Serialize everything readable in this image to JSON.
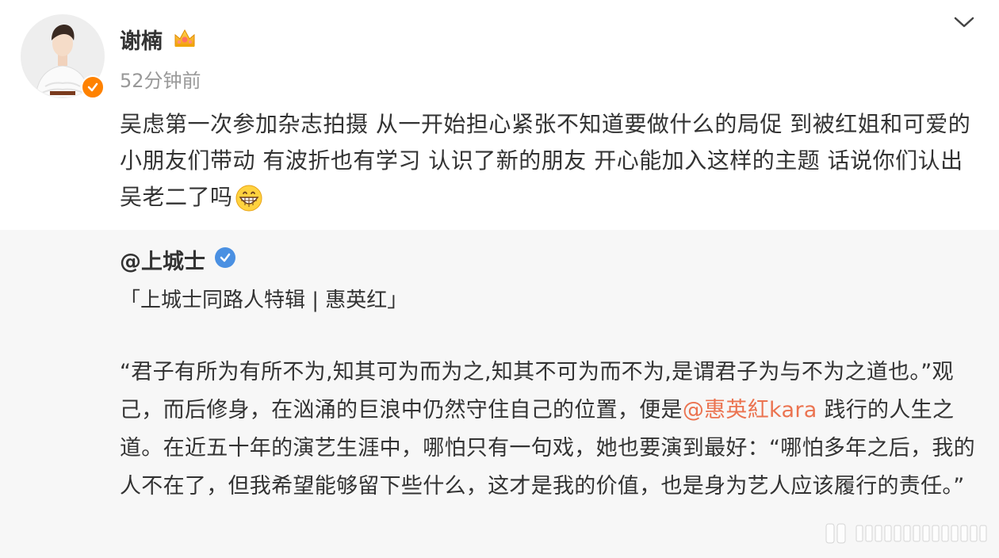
{
  "post": {
    "username": "谢楠",
    "time": "52分钟前",
    "text": "吴虑第一次参加杂志拍摄 从一开始担心紧张不知道要做什么的局促 到被红姐和可爱的小朋友们带动 有波折也有学习 认识了新的朋友 开心能加入这样的主题 话说你们认出吴老二了吗",
    "emoji": "grinning-face"
  },
  "repost": {
    "author": "@上城士",
    "title": "「上城士同路人特辑 | 惠英红」",
    "body_part1": "“君子有所为有所不为,知其可为而为之,知其不可为而不为,是谓君子为与不为之道也。”观己，而后修身，在汹涌的巨浪中仍然守住自己的位置，便是",
    "mention": "@惠英紅kara",
    "body_part2": " 践行的人生之道。在近五十年的演艺生涯中，哪怕只有一句戏，她也要演到最好：“哪怕多年之后，我的人不在了，但我希望能够留下些什么，这才是我的价值，也是身为艺人应该履行的责任。”"
  },
  "colors": {
    "text": "#333333",
    "muted": "#999999",
    "mention": "#eb7350",
    "repost_bg": "#f7f7f7",
    "orange_badge": "#ff8200",
    "blue_badge": "#4a90e2"
  },
  "icons": [
    "crown-icon",
    "verified-orange-icon",
    "verified-blue-icon",
    "chevron-down-icon",
    "grinning-face-icon",
    "watermark-logo"
  ]
}
